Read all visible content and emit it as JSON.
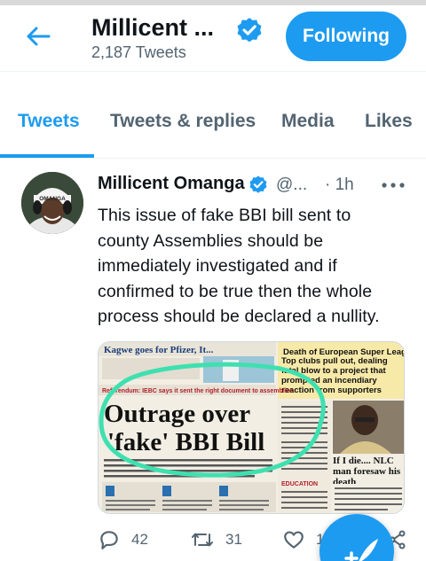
{
  "header": {
    "title": "Millicent ...",
    "tweet_count": "2,187 Tweets",
    "follow_label": "Following"
  },
  "tabs": [
    {
      "label": "Tweets",
      "active": true
    },
    {
      "label": "Tweets & replies",
      "active": false
    },
    {
      "label": "Media",
      "active": false
    },
    {
      "label": "Likes",
      "active": false
    }
  ],
  "tweet": {
    "name": "Millicent Omanga",
    "handle": "@...",
    "time": "· 1h",
    "text": "This issue of fake BBI bill sent to county Assemblies should be immediately investigated and if confirmed to be true then the whole process should be declared a nullity.",
    "avatar_label": "OMANGA",
    "media": {
      "headline_top": "Kagwe goes for Pfizer, It...",
      "side_headline": "Death of European Super League",
      "side_sub": "Top clubs pull out, dealing fatal blow to a project that prompted an incendiary reaction from supporters",
      "kicker": "Referendum: IEBC says it sent the right document to assemblies",
      "headline_line1": "Outrage over",
      "headline_line2": "'fake' BBI Bill",
      "side_story": "If I die.... NLC man foresaw his death",
      "section_label": "EDUCATION"
    },
    "replies": "42",
    "retweets": "31",
    "likes": "1"
  },
  "colors": {
    "accent": "#1d9bf0",
    "text_primary": "#0f1419",
    "text_secondary": "#536471",
    "highlight_circle": "#3fe0b0"
  }
}
